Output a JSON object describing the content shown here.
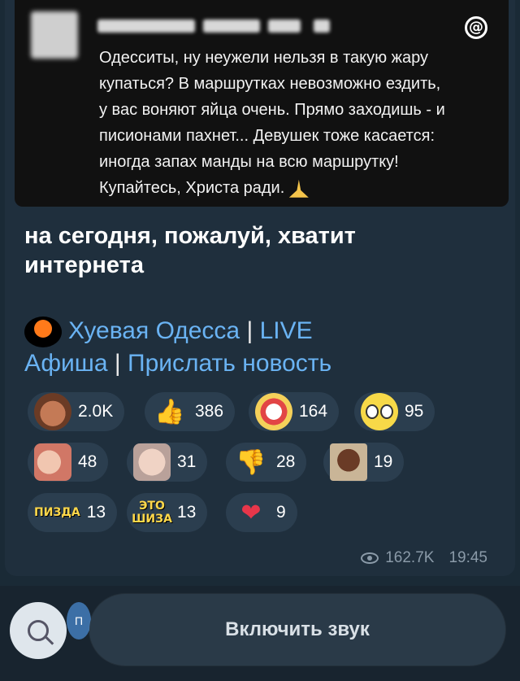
{
  "post": {
    "text": "Одесситы, ну неужели нельзя в такую жару\nкупаться? В маршрутках невозможно ездить,\nу вас воняют яйца очень. Прямо заходишь - и\nписионами пахнет... Девушек тоже касается:\nиногда запах манды на всю маршрутку!\nКупайтесь, Христа ради. "
  },
  "headline": "на сегодня, пожалуй, хватит интернета",
  "channel": {
    "logo_text": "ХУЕВАЯ ОДЕССА",
    "name": "Хуевая Одесса",
    "live": "LIVE",
    "afisha": "Афиша",
    "submit": "Прислать новость",
    "separator": " | "
  },
  "reactions": [
    {
      "icon": "laughing-face-icon",
      "count": "2.0K"
    },
    {
      "icon": "thumbs-up-icon",
      "count": "386"
    },
    {
      "icon": "clown-icon",
      "count": "164"
    },
    {
      "icon": "wide-eyes-icon",
      "count": "95"
    },
    {
      "icon": "face-sticker-icon",
      "count": "48"
    },
    {
      "icon": "face-sticker-2-icon",
      "count": "31"
    },
    {
      "icon": "thumbs-down-icon",
      "count": "28"
    },
    {
      "icon": "shocked-man-icon",
      "count": "19"
    },
    {
      "icon": "pizda-sticker-icon",
      "label": "ПИЗДА",
      "count": "13"
    },
    {
      "icon": "eto-shiza-sticker-icon",
      "label": "ЭТО ШИЗА",
      "count": "13"
    },
    {
      "icon": "heart-icon",
      "count": "9"
    }
  ],
  "meta": {
    "views": "162.7K",
    "time": "19:45"
  },
  "bottom": {
    "unmute_label": "Включить звук",
    "peek_initial": "П"
  }
}
